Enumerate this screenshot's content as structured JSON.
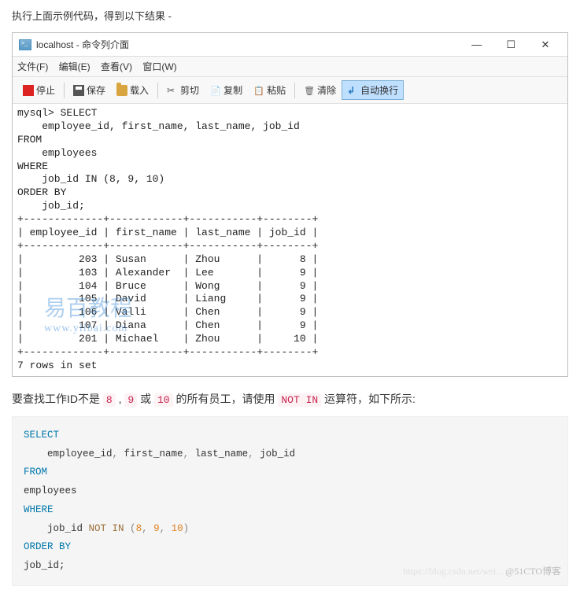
{
  "intro": "执行上面示例代码，得到以下结果 -",
  "window": {
    "title": "localhost - 命令列介面",
    "min": "—",
    "max": "☐",
    "close": "✕"
  },
  "menu": {
    "file": "文件(F)",
    "edit": "编辑(E)",
    "view": "查看(V)",
    "window": "窗口(W)"
  },
  "toolbar": {
    "stop": "停止",
    "save": "保存",
    "load": "载入",
    "cut": "剪切",
    "copy": "复制",
    "paste": "粘贴",
    "clear": "清除",
    "wrap": "自动换行"
  },
  "console": "mysql> SELECT\n    employee_id, first_name, last_name, job_id\nFROM\n    employees\nWHERE\n    job_id IN (8, 9, 10)\nORDER BY\n    job_id;\n+-------------+------------+-----------+--------+\n| employee_id | first_name | last_name | job_id |\n+-------------+------------+-----------+--------+\n|         203 | Susan      | Zhou      |      8 |\n|         103 | Alexander  | Lee       |      9 |\n|         104 | Bruce      | Wong      |      9 |\n|         105 | David      | Liang     |      9 |\n|         106 | Valli      | Chen      |      9 |\n|         107 | Diana      | Chen      |      9 |\n|         201 | Michael    | Zhou      |     10 |\n+-------------+------------+-----------+--------+\n7 rows in set",
  "watermark": {
    "line1": "易百教程",
    "line2": "www.yiibai.com"
  },
  "below": {
    "p1": "要查找工作ID不是 ",
    "c1": "8",
    "p2": " , ",
    "c2": "9",
    "p3": " 或 ",
    "c3": "10",
    "p4": " 的所有员工，请使用 ",
    "c4": "NOT IN",
    "p5": " 运算符，如下所示:"
  },
  "code": {
    "select": "SELECT",
    "cols": "    employee_id, first_name, last_name, job_id",
    "from": "FROM",
    "table": "    employees",
    "where": "WHERE",
    "cond_pre": "    job_id ",
    "notin": "NOT IN",
    "cond_vals": " (8, 9, 10)",
    "orderby": "ORDER BY",
    "ordercol": "    job_id;"
  },
  "footer": {
    "faint": "https://blog.csdn.net/wei...",
    "dark": "@51CTO博客"
  },
  "chart_data": {
    "type": "table",
    "title": "Query result",
    "columns": [
      "employee_id",
      "first_name",
      "last_name",
      "job_id"
    ],
    "rows": [
      [
        203,
        "Susan",
        "Zhou",
        8
      ],
      [
        103,
        "Alexander",
        "Lee",
        9
      ],
      [
        104,
        "Bruce",
        "Wong",
        9
      ],
      [
        105,
        "David",
        "Liang",
        9
      ],
      [
        106,
        "Valli",
        "Chen",
        9
      ],
      [
        107,
        "Diana",
        "Chen",
        9
      ],
      [
        201,
        "Michael",
        "Zhou",
        10
      ]
    ],
    "row_count_text": "7 rows in set"
  }
}
